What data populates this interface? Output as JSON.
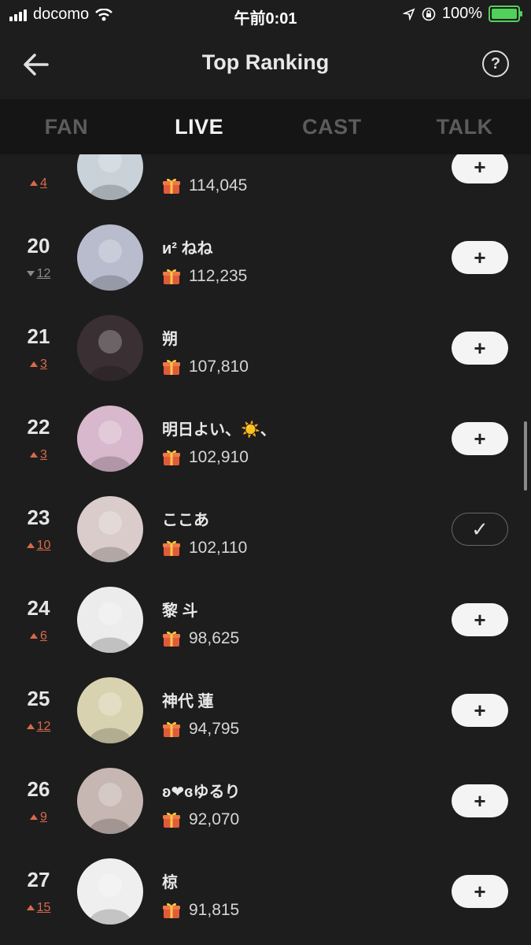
{
  "status_bar": {
    "carrier": "docomo",
    "time": "午前0:01",
    "battery": "100%"
  },
  "header": {
    "title": "Top Ranking",
    "help": "?"
  },
  "tabs": [
    {
      "label": "FAN",
      "active": false
    },
    {
      "label": "LIVE",
      "active": true
    },
    {
      "label": "CAST",
      "active": false
    },
    {
      "label": "TALK",
      "active": false
    }
  ],
  "rows": [
    {
      "rank": "",
      "change_dir": "up",
      "change": "4",
      "name": "",
      "score": "114,045",
      "followed": false,
      "avatar_color": "#c9d2d8"
    },
    {
      "rank": "20",
      "change_dir": "down",
      "change": "12",
      "name": "и² ねね",
      "score": "112,235",
      "followed": false,
      "avatar_color": "#b8bccc"
    },
    {
      "rank": "21",
      "change_dir": "up",
      "change": "3",
      "name": "朔",
      "score": "107,810",
      "followed": false,
      "avatar_color": "#3a2f33"
    },
    {
      "rank": "22",
      "change_dir": "up",
      "change": "3",
      "name": "明日よい、☀️、",
      "score": "102,910",
      "followed": false,
      "avatar_color": "#d8b8cc"
    },
    {
      "rank": "23",
      "change_dir": "up",
      "change": "10",
      "name": "ここあ",
      "score": "102,110",
      "followed": true,
      "avatar_color": "#d9cccb"
    },
    {
      "rank": "24",
      "change_dir": "up",
      "change": "6",
      "name": "黎 斗",
      "score": "98,625",
      "followed": false,
      "avatar_color": "#ececec"
    },
    {
      "rank": "25",
      "change_dir": "up",
      "change": "12",
      "name": "神代 蓮",
      "score": "94,795",
      "followed": false,
      "avatar_color": "#d9d2b0"
    },
    {
      "rank": "26",
      "change_dir": "up",
      "change": "9",
      "name": "ʚ❤︎ɞゆるり",
      "score": "92,070",
      "followed": false,
      "avatar_color": "#c7b7b2"
    },
    {
      "rank": "27",
      "change_dir": "up",
      "change": "15",
      "name": "椋",
      "score": "91,815",
      "followed": false,
      "avatar_color": "#efefef"
    }
  ],
  "buttons": {
    "follow": "+",
    "followed": "✓"
  }
}
